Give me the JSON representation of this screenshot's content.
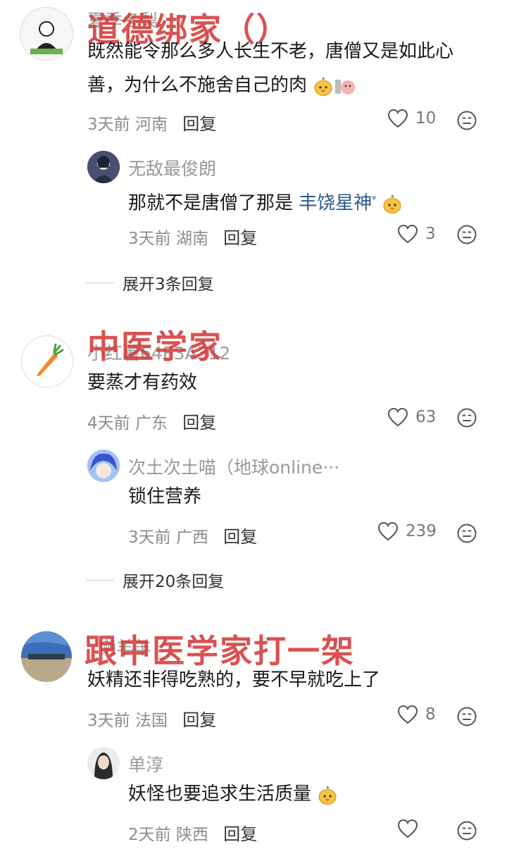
{
  "comments": [
    {
      "username": "夏季冬梨",
      "overlay": "道德绑家（）",
      "text_line1": "既然能令那么多人长生不老，唐僧又是如此心",
      "text_line2": "善，为什么不施舍自己的肉",
      "time": "3天前",
      "location": "河南",
      "reply_label": "回复",
      "likes": "10",
      "reply": {
        "username": "无敌最俊朗",
        "text_prefix": "那就不是唐僧了那是",
        "link": "丰饶星神",
        "time": "3天前",
        "location": "湖南",
        "reply_label": "回复",
        "likes": "3"
      },
      "expand": "展开3条回复"
    },
    {
      "username": "小红薯64E3A312",
      "overlay": "中医学家",
      "text": "要蒸才有药效",
      "time": "4天前",
      "location": "广东",
      "reply_label": "回复",
      "likes": "63",
      "reply": {
        "username": "次土次土喵（地球online···",
        "text": "锁住营养",
        "time": "3天前",
        "location": "广西",
        "reply_label": "回复",
        "likes": "239"
      },
      "expand": "展开20条回复"
    },
    {
      "username": "懒羊羊",
      "overlay": "跟中医学家打一架",
      "text": "妖精还非得吃熟的，要不早就吃上了",
      "time": "3天前",
      "location": "法国",
      "reply_label": "回复",
      "likes": "8",
      "reply": {
        "username": "单淳",
        "text": "妖怪也要追求生活质量",
        "time": "2天前",
        "location": "陕西",
        "reply_label": "回复",
        "likes": ""
      }
    }
  ]
}
